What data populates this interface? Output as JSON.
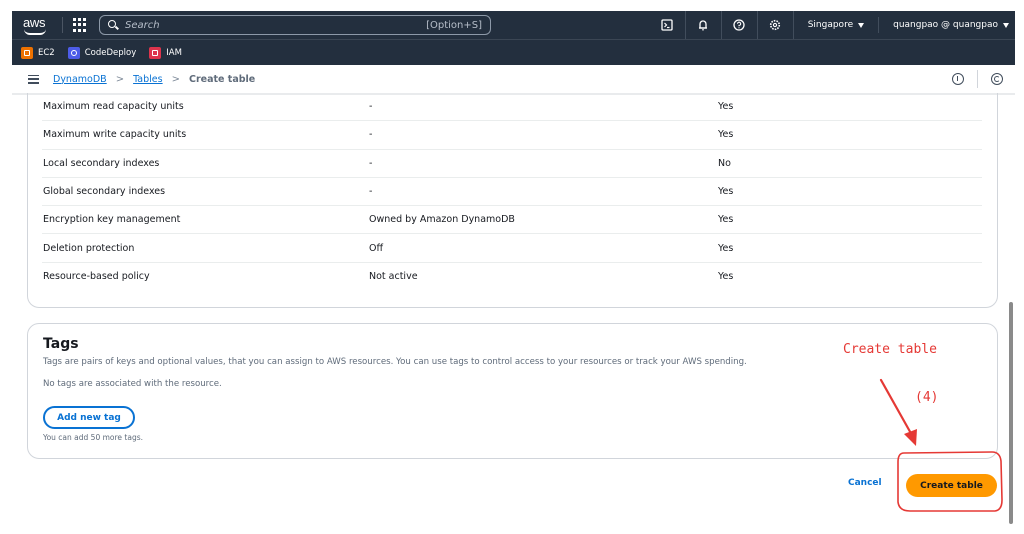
{
  "topnav": {
    "logo": "aws",
    "search_placeholder": "Search",
    "search_shortcut": "[Option+S]",
    "icons": [
      "cloudshell-icon",
      "bell-icon",
      "help-icon",
      "settings-icon"
    ],
    "region": "Singapore",
    "account": "quangpao @ quangpao"
  },
  "favorites": [
    {
      "label": "EC2",
      "color": "#ed7100"
    },
    {
      "label": "CodeDeploy",
      "color": "#4d5ce8"
    },
    {
      "label": "IAM",
      "color": "#dd344c"
    }
  ],
  "breadcrumb": {
    "items": [
      "DynamoDB",
      "Tables"
    ],
    "current": "Create table",
    "separator": ">"
  },
  "settings_rows": [
    {
      "name": "Maximum read capacity units",
      "value": "-",
      "editable": "Yes"
    },
    {
      "name": "Maximum write capacity units",
      "value": "-",
      "editable": "Yes"
    },
    {
      "name": "Local secondary indexes",
      "value": "-",
      "editable": "No"
    },
    {
      "name": "Global secondary indexes",
      "value": "-",
      "editable": "Yes"
    },
    {
      "name": "Encryption key management",
      "value": "Owned by Amazon DynamoDB",
      "editable": "Yes"
    },
    {
      "name": "Deletion protection",
      "value": "Off",
      "editable": "Yes"
    },
    {
      "name": "Resource-based policy",
      "value": "Not active",
      "editable": "Yes"
    }
  ],
  "tags": {
    "title": "Tags",
    "description": "Tags are pairs of keys and optional values, that you can assign to AWS resources. You can use tags to control access to your resources or track your AWS spending.",
    "empty_message": "No tags are associated with the resource.",
    "add_button": "Add new tag",
    "limit_text": "You can add 50 more tags."
  },
  "actions": {
    "cancel": "Cancel",
    "create": "Create table"
  },
  "annotation": {
    "label": "Create table",
    "step": "(4)",
    "color": "#e53935"
  },
  "colors": {
    "nav_bg": "#232f3e",
    "link": "#0972d3",
    "primary_button": "#ff9900"
  }
}
